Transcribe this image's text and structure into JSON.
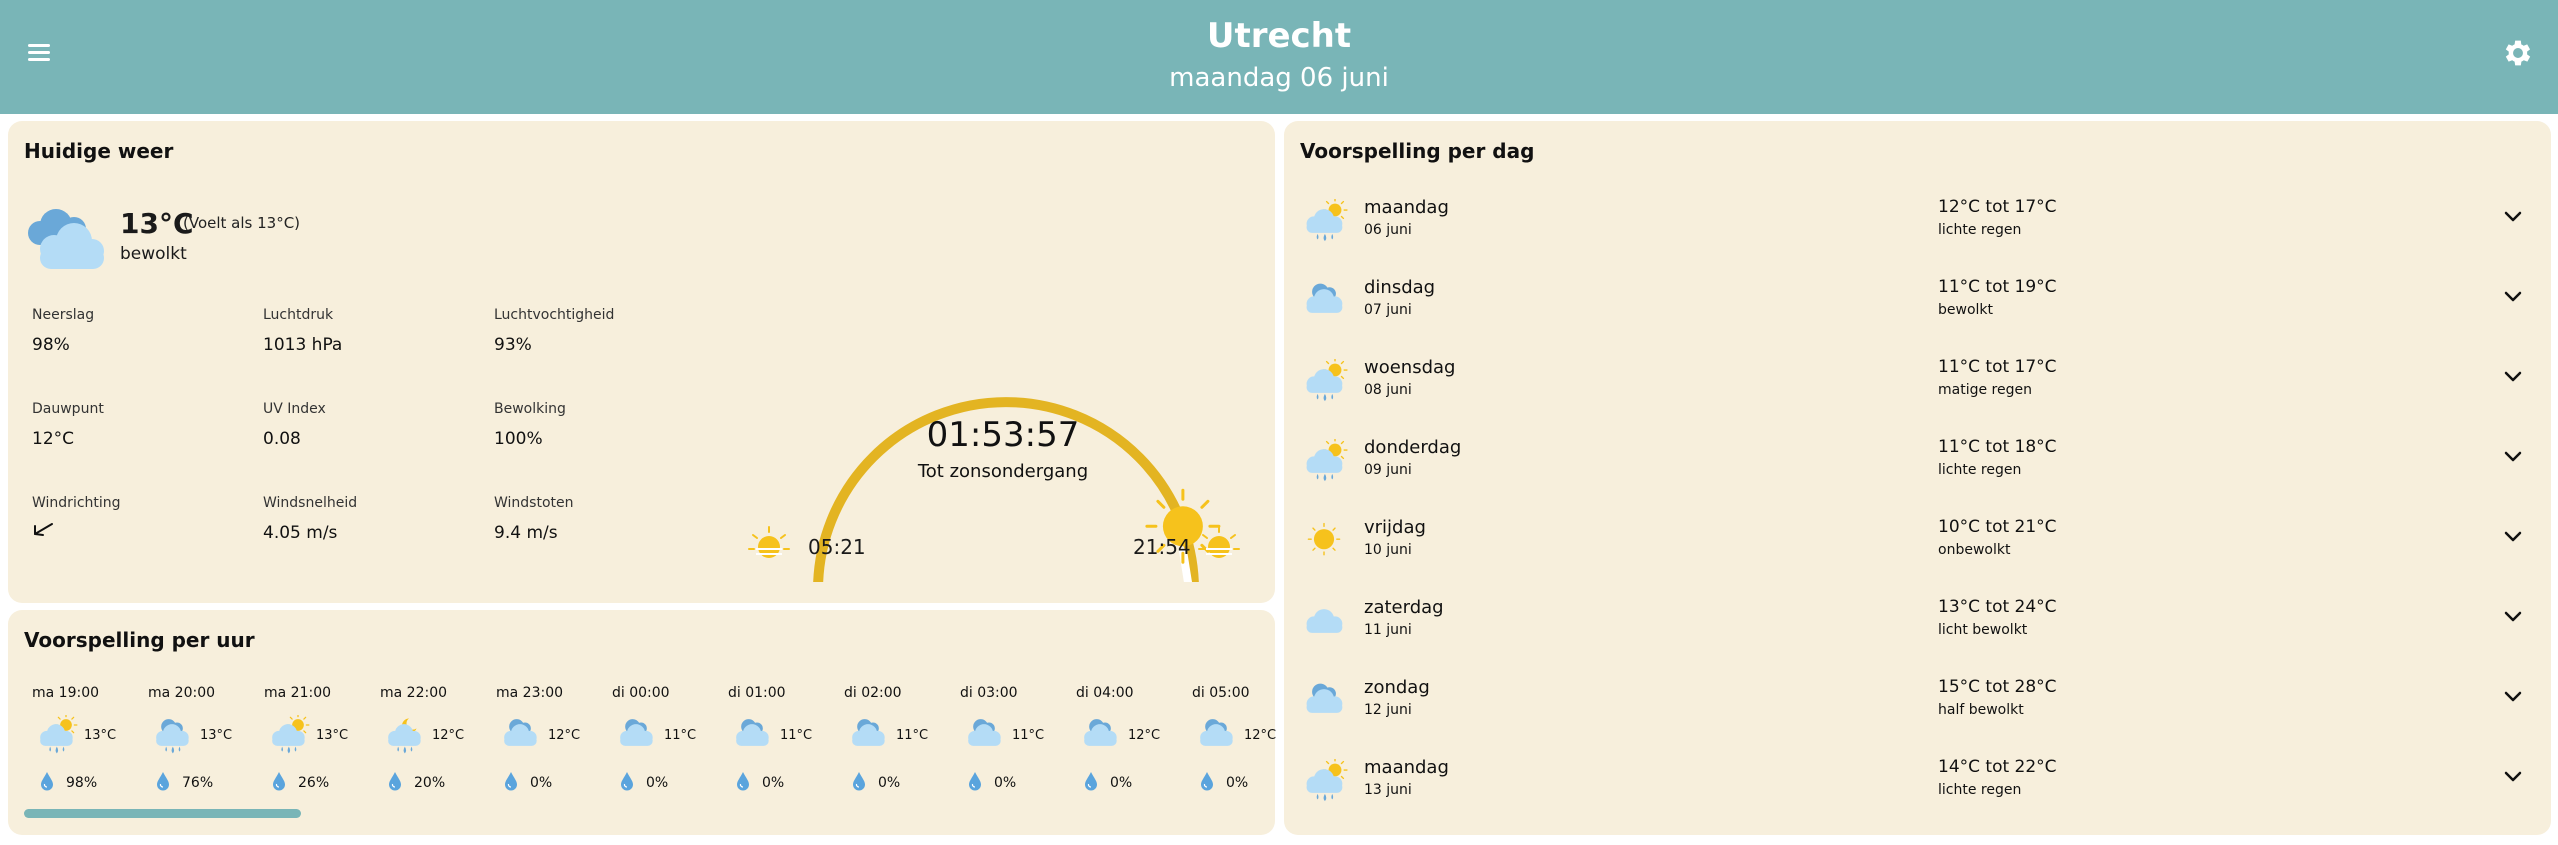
{
  "header": {
    "city": "Utrecht",
    "date": "maandag 06 juni"
  },
  "current": {
    "title": "Huidige weer",
    "temp": "13°C",
    "feels_like": "(Voelt als 13°C)",
    "description": "bewolkt",
    "icon": "cloudy-icon",
    "metrics": {
      "precipitation": {
        "label": "Neerslag",
        "value": "98%"
      },
      "pressure": {
        "label": "Luchtdruk",
        "value": "1013 hPa"
      },
      "humidity": {
        "label": "Luchtvochtigheid",
        "value": "93%"
      },
      "dewpoint": {
        "label": "Dauwpunt",
        "value": "12°C"
      },
      "uv": {
        "label": "UV Index",
        "value": "0.08"
      },
      "cloudiness": {
        "label": "Bewolking",
        "value": "100%"
      },
      "wind_direction": {
        "label": "Windrichting",
        "icon": "wind-arrow-icon"
      },
      "wind_speed": {
        "label": "Windsnelheid",
        "value": "4.05 m/s"
      },
      "wind_gusts": {
        "label": "Windstoten",
        "value": "9.4 m/s"
      }
    },
    "sun": {
      "countdown": "01:53:57",
      "countdown_label": "Tot zonsondergang",
      "sunrise": "05:21",
      "sunset": "21:54",
      "day_progress": 0.89
    }
  },
  "hourly": {
    "title": "Voorspelling per uur",
    "items": [
      {
        "time": "ma 19:00",
        "temp": "13°C",
        "precip": "98%",
        "icon": "sun-cloud-rain-icon"
      },
      {
        "time": "ma 20:00",
        "temp": "13°C",
        "precip": "76%",
        "icon": "cloud-rain-icon"
      },
      {
        "time": "ma 21:00",
        "temp": "13°C",
        "precip": "26%",
        "icon": "sun-cloud-rain-icon"
      },
      {
        "time": "ma 22:00",
        "temp": "12°C",
        "precip": "20%",
        "icon": "moon-cloud-rain-icon"
      },
      {
        "time": "ma 23:00",
        "temp": "12°C",
        "precip": "0%",
        "icon": "cloudy-icon"
      },
      {
        "time": "di 00:00",
        "temp": "11°C",
        "precip": "0%",
        "icon": "cloudy-icon"
      },
      {
        "time": "di 01:00",
        "temp": "11°C",
        "precip": "0%",
        "icon": "cloudy-icon"
      },
      {
        "time": "di 02:00",
        "temp": "11°C",
        "precip": "0%",
        "icon": "cloudy-icon"
      },
      {
        "time": "di 03:00",
        "temp": "11°C",
        "precip": "0%",
        "icon": "cloudy-icon"
      },
      {
        "time": "di 04:00",
        "temp": "12°C",
        "precip": "0%",
        "icon": "cloudy-icon"
      },
      {
        "time": "di 05:00",
        "temp": "12°C",
        "precip": "0%",
        "icon": "cloudy-icon"
      }
    ]
  },
  "daily": {
    "title": "Voorspelling per dag",
    "items": [
      {
        "day": "maandag",
        "date": "06 juni",
        "range": "12°C tot 17°C",
        "condition": "lichte regen",
        "icon": "sun-cloud-rain-icon"
      },
      {
        "day": "dinsdag",
        "date": "07 juni",
        "range": "11°C tot 19°C",
        "condition": "bewolkt",
        "icon": "cloudy-icon"
      },
      {
        "day": "woensdag",
        "date": "08 juni",
        "range": "11°C tot 17°C",
        "condition": "matige regen",
        "icon": "sun-cloud-rain-icon"
      },
      {
        "day": "donderdag",
        "date": "09 juni",
        "range": "11°C tot 18°C",
        "condition": "lichte regen",
        "icon": "sun-cloud-rain-icon"
      },
      {
        "day": "vrijdag",
        "date": "10 juni",
        "range": "10°C tot 21°C",
        "condition": "onbewolkt",
        "icon": "sun-icon"
      },
      {
        "day": "zaterdag",
        "date": "11 juni",
        "range": "13°C tot 24°C",
        "condition": "licht bewolkt",
        "icon": "cloud-icon"
      },
      {
        "day": "zondag",
        "date": "12 juni",
        "range": "15°C tot 28°C",
        "condition": "half bewolkt",
        "icon": "cloudy-icon"
      },
      {
        "day": "maandag",
        "date": "13 juni",
        "range": "14°C tot 22°C",
        "condition": "lichte regen",
        "icon": "sun-cloud-rain-icon"
      }
    ]
  },
  "colors": {
    "header": "#79b5b7",
    "panel": "#f7efdc",
    "sun": "#f6c21c",
    "arc": "#e3b422",
    "cloud_light": "#b4dcf6",
    "cloud_dark": "#6aa8d8",
    "drop": "#5aa4dd"
  }
}
